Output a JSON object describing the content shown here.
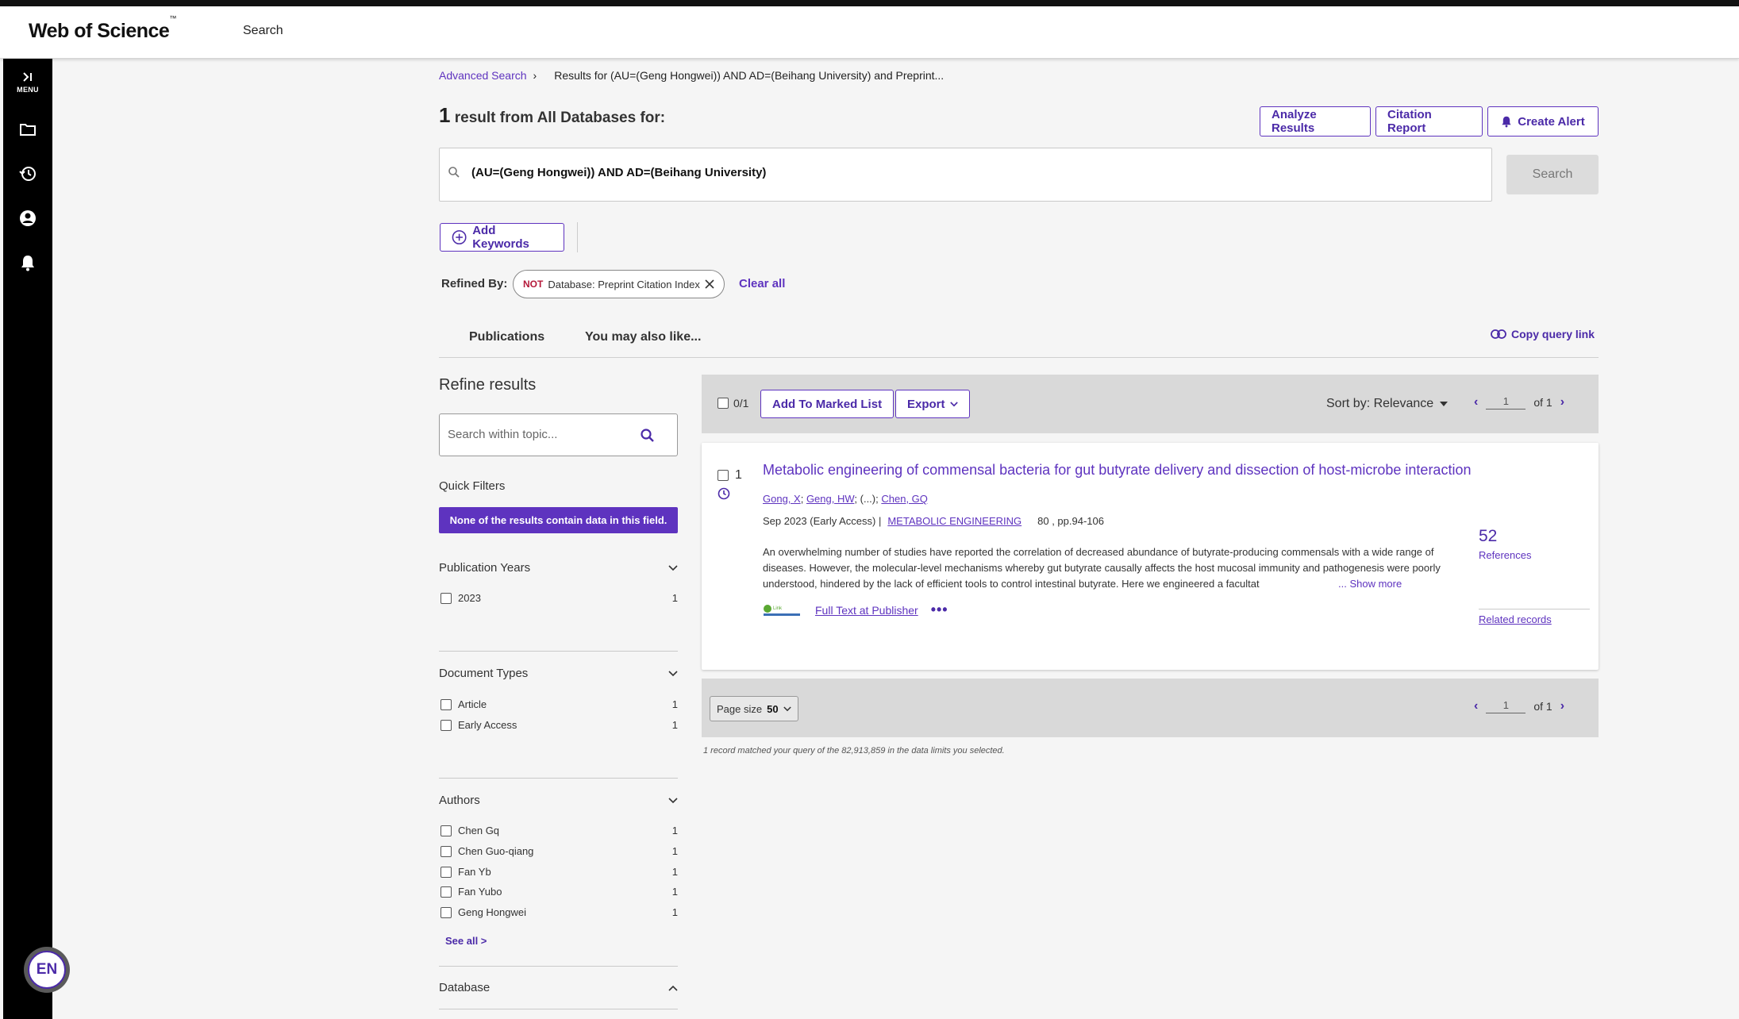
{
  "header": {
    "logo": "Web of Science",
    "logo_tm": "™",
    "nav_search": "Search"
  },
  "sidebar": {
    "menu_label": "MENU",
    "language": "EN"
  },
  "breadcrumb": {
    "advanced": "Advanced Search",
    "separator": "›",
    "current": "Results for (AU=(Geng Hongwei)) AND AD=(Beihang University) and Preprint..."
  },
  "results_header": {
    "count": "1",
    "text": "result from All Databases for:"
  },
  "actions": {
    "analyze": "Analyze Results",
    "citation": "Citation Report",
    "alert": "Create Alert"
  },
  "search": {
    "query": "(AU=(Geng Hongwei)) AND AD=(Beihang University)",
    "button": "Search"
  },
  "add_keywords": "Add Keywords",
  "refined": {
    "label": "Refined By:",
    "chip_not": "NOT",
    "chip_text": "Database: Preprint Citation Index",
    "clear_all": "Clear all"
  },
  "tabs": {
    "publications": "Publications",
    "may_like": "You may also like...",
    "copy_link": "Copy query link"
  },
  "refine": {
    "title": "Refine results",
    "search_placeholder": "Search within topic...",
    "quick_filters": "Quick Filters",
    "quick_banner": "None of the results contain data in this field.",
    "pub_years": {
      "title": "Publication Years",
      "items": [
        {
          "label": "2023",
          "count": "1"
        }
      ]
    },
    "doc_types": {
      "title": "Document Types",
      "items": [
        {
          "label": "Article",
          "count": "1"
        },
        {
          "label": "Early Access",
          "count": "1"
        }
      ]
    },
    "authors": {
      "title": "Authors",
      "items": [
        {
          "label": "Chen Gq",
          "count": "1"
        },
        {
          "label": "Chen Guo-qiang",
          "count": "1"
        },
        {
          "label": "Fan Yb",
          "count": "1"
        },
        {
          "label": "Fan Yubo",
          "count": "1"
        },
        {
          "label": "Geng Hongwei",
          "count": "1"
        }
      ],
      "see_all": "See all >"
    },
    "database": {
      "title": "Database"
    }
  },
  "toolbar": {
    "selected": "0/1",
    "add_marked": "Add To Marked List",
    "export": "Export",
    "sort": "Sort by: Relevance",
    "page": "1",
    "of": "of 1"
  },
  "result": {
    "index": "1",
    "title": "Metabolic engineering of commensal bacteria for gut butyrate delivery and dissection of host-microbe interaction",
    "authors": [
      "Gong, X",
      "Geng, HW",
      "(...)",
      "Chen, GQ"
    ],
    "date": "Sep 2023 (Early Access) |",
    "journal": "METABOLIC ENGINEERING",
    "volume": "80 , pp.94-106",
    "abstract": "An overwhelming number of studies have reported the correlation of decreased abundance of butyrate-producing commensals with a wide range of diseases. However, the molecular-level mechanisms whereby gut butyrate causally affects the host mucosal immunity and pathogenesis were poorly understood, hindered by the lack of efficient tools to control intestinal butyrate. Here we engineered a facultat",
    "show_more": "...   Show more",
    "linkout_text": "Link",
    "full_text": "Full Text at Publisher",
    "more": "•••",
    "references_count": "52",
    "references_label": "References",
    "related": "Related records"
  },
  "bottom": {
    "page_size_label": "Page size",
    "page_size": "50",
    "page": "1",
    "of": "of 1"
  },
  "matched_text": "1 record matched your query of the 82,913,859 in the data limits you selected."
}
